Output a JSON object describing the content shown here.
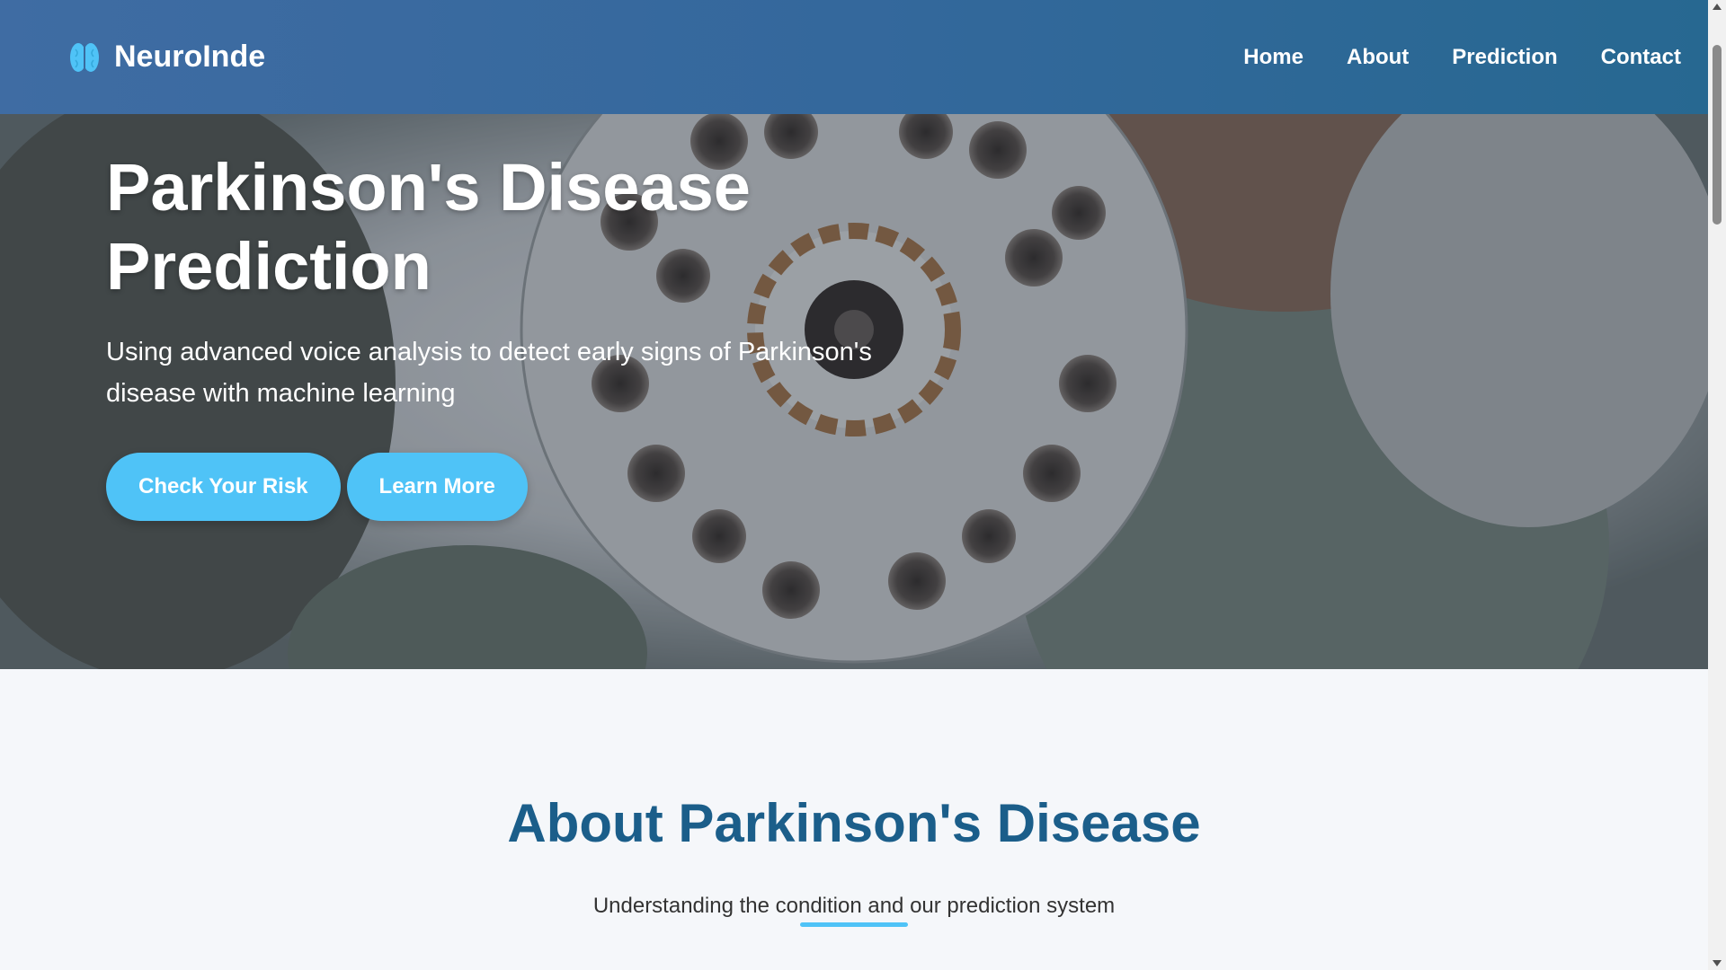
{
  "navbar": {
    "brand_name": "NeuroInde",
    "brand_icon": "brain-icon",
    "links": [
      {
        "label": "Home"
      },
      {
        "label": "About"
      },
      {
        "label": "Prediction"
      },
      {
        "label": "Contact"
      }
    ]
  },
  "hero": {
    "title_line1": "Parkinson's Disease",
    "title_line2": "Prediction",
    "subtitle": "Using advanced voice analysis to detect early signs of Parkinson's disease with machine learning",
    "primary_button": "Check Your Risk",
    "secondary_button": "Learn More"
  },
  "about": {
    "title": "About Parkinson's Disease",
    "subtitle": "Understanding the condition and our prediction system"
  },
  "colors": {
    "accent": "#4fc3f7",
    "heading": "#1b5e8a",
    "nav_gradient_start": "#3f6ca3",
    "nav_gradient_end": "#276891"
  }
}
